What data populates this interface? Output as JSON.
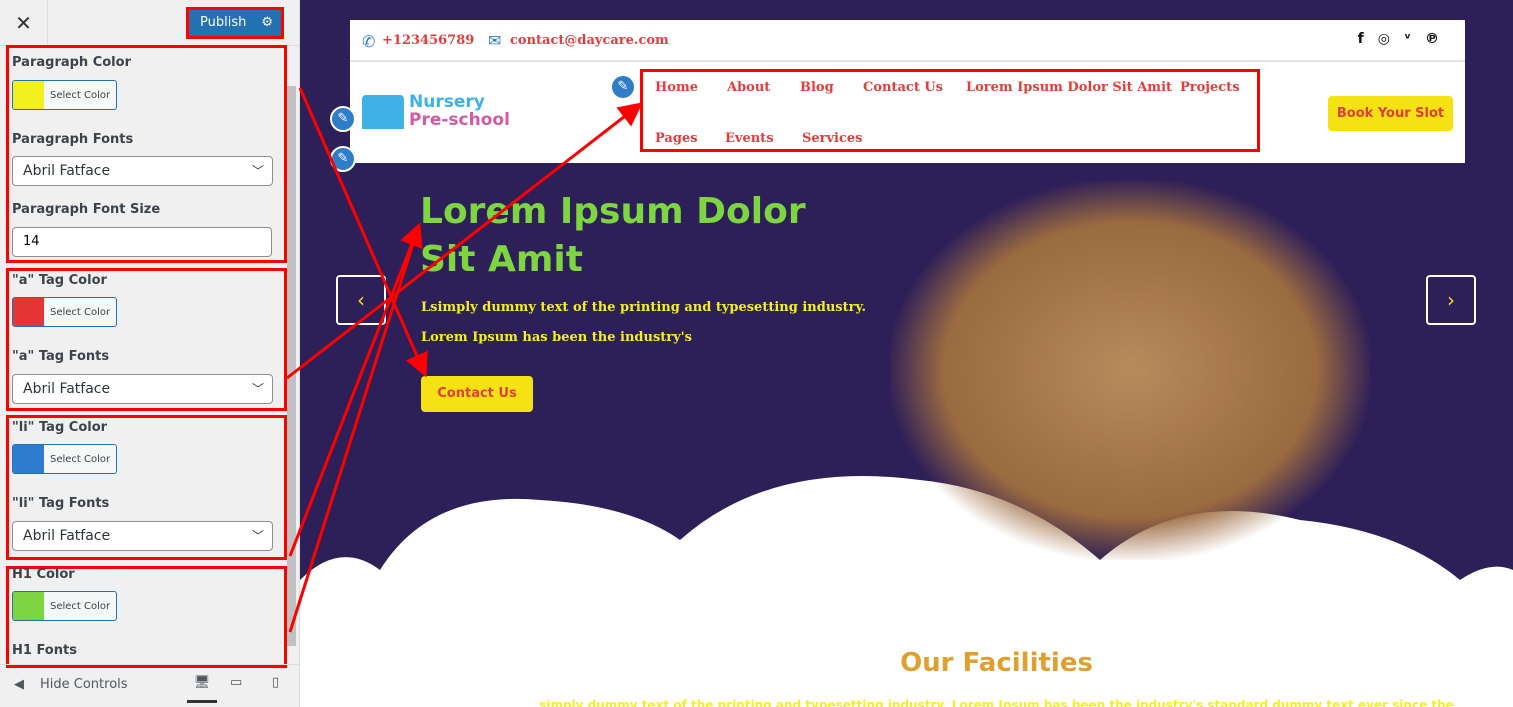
{
  "sidebar": {
    "close": "✕",
    "publish": "Publish",
    "paragraph_color": "Paragraph Color",
    "select_color": "Select Color",
    "paragraph_fonts": "Paragraph Fonts",
    "paragraph_font_value": "Abril Fatface",
    "paragraph_font_size": "Paragraph Font Size",
    "paragraph_font_size_value": "14",
    "a_color": "\"a\" Tag Color",
    "a_fonts": "\"a\" Tag Fonts",
    "a_font_value": "Abril Fatface",
    "li_color": "\"li\" Tag Color",
    "li_fonts": "\"li\" Tag Fonts",
    "li_font_value": "Abril Fatface",
    "h1_color": "H1 Color",
    "h1_fonts": "H1 Fonts",
    "hide_controls": "Hide Controls",
    "swatches": {
      "paragraph": "#f3f021",
      "a": "#e53535",
      "li": "#2f7bd0",
      "h1": "#7dd640"
    }
  },
  "preview": {
    "phone": "+123456789",
    "email": "contact@daycare.com",
    "logo_line1": "Nursery",
    "logo_line2": "Pre-school",
    "nav": [
      "Home",
      "About",
      "Blog",
      "Contact Us",
      "Lorem Ipsum Dolor Sit Amit",
      "Projects",
      "Pages",
      "Events",
      "Services"
    ],
    "book": "Book Your Slot",
    "hero_title": "Lorem Ipsum Dolor Sit Amit",
    "hero_p1": "Lsimply dummy text of the printing and typesetting industry.",
    "hero_p2": "Lorem Ipsum has been the industry's",
    "hero_button": "Contact Us",
    "facilities_title": "Our Facilities",
    "facilities_text": "simply dummy text of the printing and typesetting industry. Lorem Ipsum has been the industry's standard dummy text ever since the"
  }
}
